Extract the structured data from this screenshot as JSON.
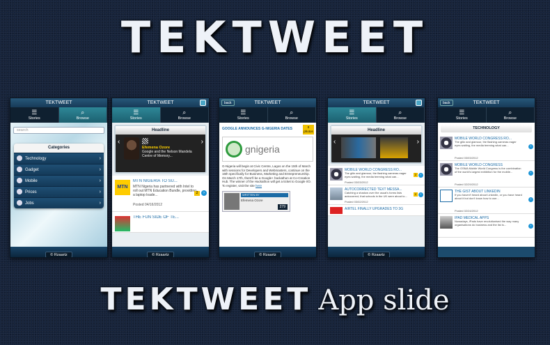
{
  "title_top": "TEKTWEET",
  "title_bottom": {
    "brand": "TEKTWEET",
    "suffix": "App slide"
  },
  "common": {
    "app_name": "TEKTWEET",
    "footer": "© Rzaartz",
    "tab_stories": "Stories",
    "tab_browse": "Browse",
    "back": "back"
  },
  "phone1": {
    "search_placeholder": "search",
    "categories_title": "Categories",
    "categories": [
      "Technology",
      "Gadget",
      "Mobile",
      "Prices",
      "Jobs"
    ]
  },
  "phone2": {
    "headline_title": "Headline",
    "headline_name": "Efemena Ozore",
    "headline_text": "Google and the Nelson Mandela Centre of Memory...",
    "news": [
      {
        "title": "MTN NIGERIA TO SU...",
        "thumb": "MTN",
        "desc": "MTN Nigeria has partnered with Intel to roll out MTN Education Bundle, providing a laptop loade...",
        "date": "Posted 04/16/2012",
        "count": "2"
      },
      {
        "title": "THE FUN SIDE OF TE...",
        "thumb": "",
        "desc": "",
        "date": "",
        "count": ""
      }
    ]
  },
  "phone3": {
    "article_title": "GOOGLE ANNOUNCES G-NIGERIA DATES",
    "likes_count": "0",
    "likes_label": "photos",
    "logo_text": "gnigeria",
    "body": "G-Nigeria will begin at Civic Centre, Lagos on the 15th of March with sessions for Developers and Webmasters, continue on the 16th specifically for Business, Marketing and Entrepreneurship. On March 17th, there'll be a Google+ hackathon at Co-Creation Hub. The winner of the Hackathon will get a ticket to Google I/O. To register, visit the site",
    "body_link": "here",
    "writer_label": "WRITTEN BY",
    "writer_name": "Efemena Ozore",
    "count": "279"
  },
  "phone4": {
    "headline_title": "Headline",
    "news": [
      {
        "title": "MOBILE WORLD CONGRESS RO...",
        "desc": "The glitz and glamour, the flashing cameras eager eyes waiting, the media teeming what can...",
        "date": "Posted 03/03/2012",
        "count": "2"
      },
      {
        "title": "AUTOCORRECTED TEXT MESSA...",
        "desc": "Catching a shadow over the usual's forms lists autocorrect, that schools in the UK were about to...",
        "date": "Posted 03/02/2012",
        "count": "2"
      },
      {
        "title": "AIRTEL FINALLY UPGRADES TO 3G",
        "desc": "",
        "date": "",
        "count": ""
      }
    ]
  },
  "phone5": {
    "section_title": "TECHNOLOGY",
    "news": [
      {
        "title": "MOBILE WORLD CONGRESS RO...",
        "desc": "The glitz and glamour, the flashing cameras eager eyes waiting, the media teeming what can...",
        "date": "Posted 03/03/2012"
      },
      {
        "title": "MOBILE WORLD CONGRESS",
        "desc": "The GSMA Mobile World Congress is the combination of the world's largest exhibition for the mobile...",
        "date": "Posted 02/29/2012"
      },
      {
        "title": "THE GIST ABOUT LINKEDIN",
        "desc": "If you haven't heard about LinkedIn, or you have heard about it but don't know how to use...",
        "date": "Posted 02/24/2012"
      },
      {
        "title": "IPAD MEDICAL APPS",
        "desc": "Nowadays, iPads have revolutionised the way many organisations do business and the list is...",
        "date": ""
      }
    ]
  }
}
